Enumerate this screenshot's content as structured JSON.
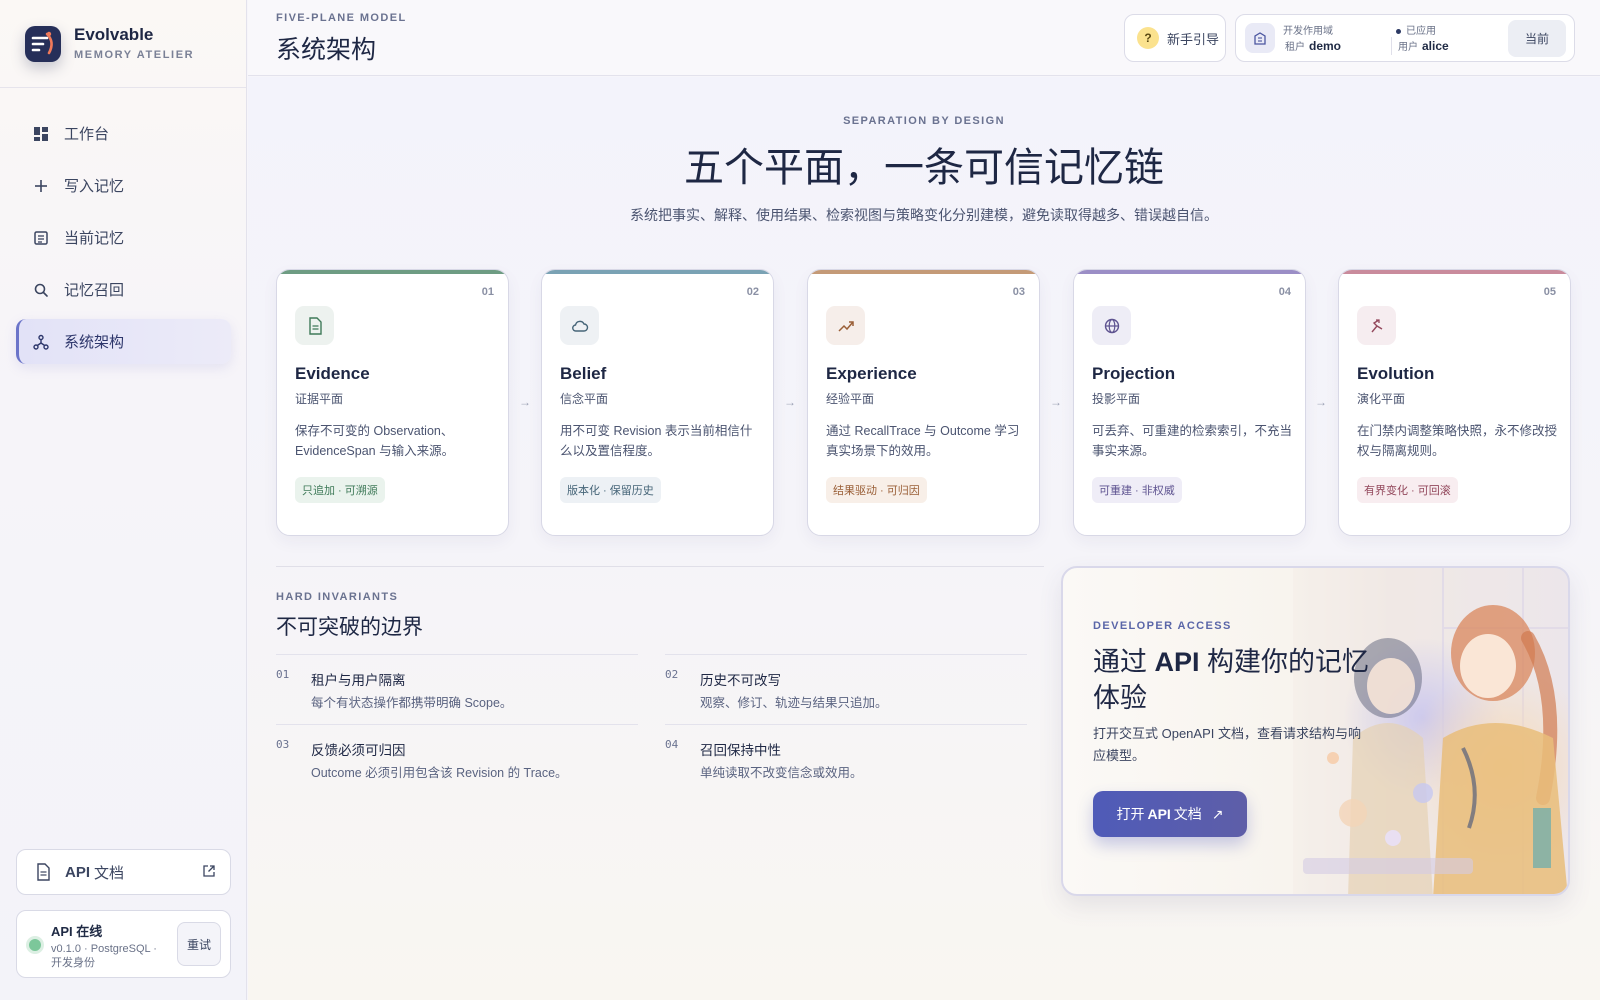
{
  "brand": {
    "name": "Evolvable",
    "subtitle": "MEMORY ATELIER"
  },
  "sidebar": {
    "items": [
      {
        "label": "工作台",
        "icon": "dashboard-icon",
        "active": false
      },
      {
        "label": "写入记忆",
        "icon": "plus-icon",
        "active": false
      },
      {
        "label": "当前记忆",
        "icon": "list-icon",
        "active": false
      },
      {
        "label": "记忆召回",
        "icon": "search-icon",
        "active": false
      },
      {
        "label": "系统架构",
        "icon": "network-icon",
        "active": true
      }
    ],
    "api_doc": {
      "prefix": "API",
      "label": "文档"
    },
    "status": {
      "title": "API 在线",
      "detail": "v0.1.0 · PostgreSQL · 开发身份",
      "retry": "重试"
    }
  },
  "header": {
    "eyebrow": "FIVE-PLANE MODEL",
    "title": "系统架构",
    "guide": "新手引导",
    "scope": {
      "env_label": "开发作用域",
      "tenant_label": "租户",
      "tenant": "demo",
      "applied_label": "已应用",
      "user_label": "用户",
      "user": "alice",
      "current": "当前"
    }
  },
  "hero": {
    "eyebrow": "SEPARATION BY DESIGN",
    "title": "五个平面，一条可信记忆链",
    "subtitle": "系统把事实、解释、使用结果、检索视图与策略变化分别建模，避免读取得越多、错误越自信。"
  },
  "planes": [
    {
      "num": "01",
      "name": "Evidence",
      "cn": "证据平面",
      "desc": "保存不可变的 Observation、EvidenceSpan 与输入来源。",
      "tag": "只追加 · 可溯源",
      "accent": "#6e9c83",
      "tint": "#edf2ef",
      "tag_fg": "#3f7a59",
      "tag_bg": "#eaf3ed",
      "icon": "document-icon"
    },
    {
      "num": "02",
      "name": "Belief",
      "cn": "信念平面",
      "desc": "用不可变 Revision 表示当前相信什么以及置信程度。",
      "tag": "版本化 · 保留历史",
      "accent": "#7aa2b4",
      "tint": "#eef1f4",
      "tag_fg": "#466578",
      "tag_bg": "#edf1f5",
      "icon": "cloud-icon"
    },
    {
      "num": "03",
      "name": "Experience",
      "cn": "经验平面",
      "desc": "通过 RecallTrace 与 Outcome 学习真实场景下的效用。",
      "tag": "结果驱动 · 可归因",
      "accent": "#c49a77",
      "tint": "#f6eeea",
      "tag_fg": "#9a5f37",
      "tag_bg": "#f8efe8",
      "icon": "trend-icon"
    },
    {
      "num": "04",
      "name": "Projection",
      "cn": "投影平面",
      "desc": "可丢弃、可重建的检索索引，不充当事实来源。",
      "tag": "可重建 · 非权威",
      "accent": "#9b8ec6",
      "tint": "#eeedf6",
      "tag_fg": "#5e5390",
      "tag_bg": "#efedf7",
      "icon": "globe-icon"
    },
    {
      "num": "05",
      "name": "Evolution",
      "cn": "演化平面",
      "desc": "在门禁内调整策略快照，永不修改授权与隔离规则。",
      "tag": "有界变化 · 可回滚",
      "accent": "#c98b9c",
      "tint": "#f6edf0",
      "tag_fg": "#93485c",
      "tag_bg": "#f8edf0",
      "icon": "evolve-icon"
    }
  ],
  "invariants": {
    "eyebrow": "HARD INVARIANTS",
    "title": "不可突破的边界",
    "items": [
      {
        "num": "01",
        "title": "租户与用户隔离",
        "desc": "每个有状态操作都携带明确 Scope。"
      },
      {
        "num": "02",
        "title": "历史不可改写",
        "desc": "观察、修订、轨迹与结果只追加。"
      },
      {
        "num": "03",
        "title": "反馈必须可归因",
        "desc": "Outcome 必须引用包含该 Revision 的 Trace。"
      },
      {
        "num": "04",
        "title": "召回保持中性",
        "desc": "单纯读取不改变信念或效用。"
      }
    ]
  },
  "developer": {
    "eyebrow": "DEVELOPER ACCESS",
    "title_pre": "通过",
    "title_api": "API",
    "title_post": "构建你的记忆体验",
    "desc": "打开交互式 OpenAPI 文档，查看请求结构与响应模型。",
    "btn_pre": "打开",
    "btn_api": "API",
    "btn_post": "文档",
    "btn_arrow": "↗"
  }
}
